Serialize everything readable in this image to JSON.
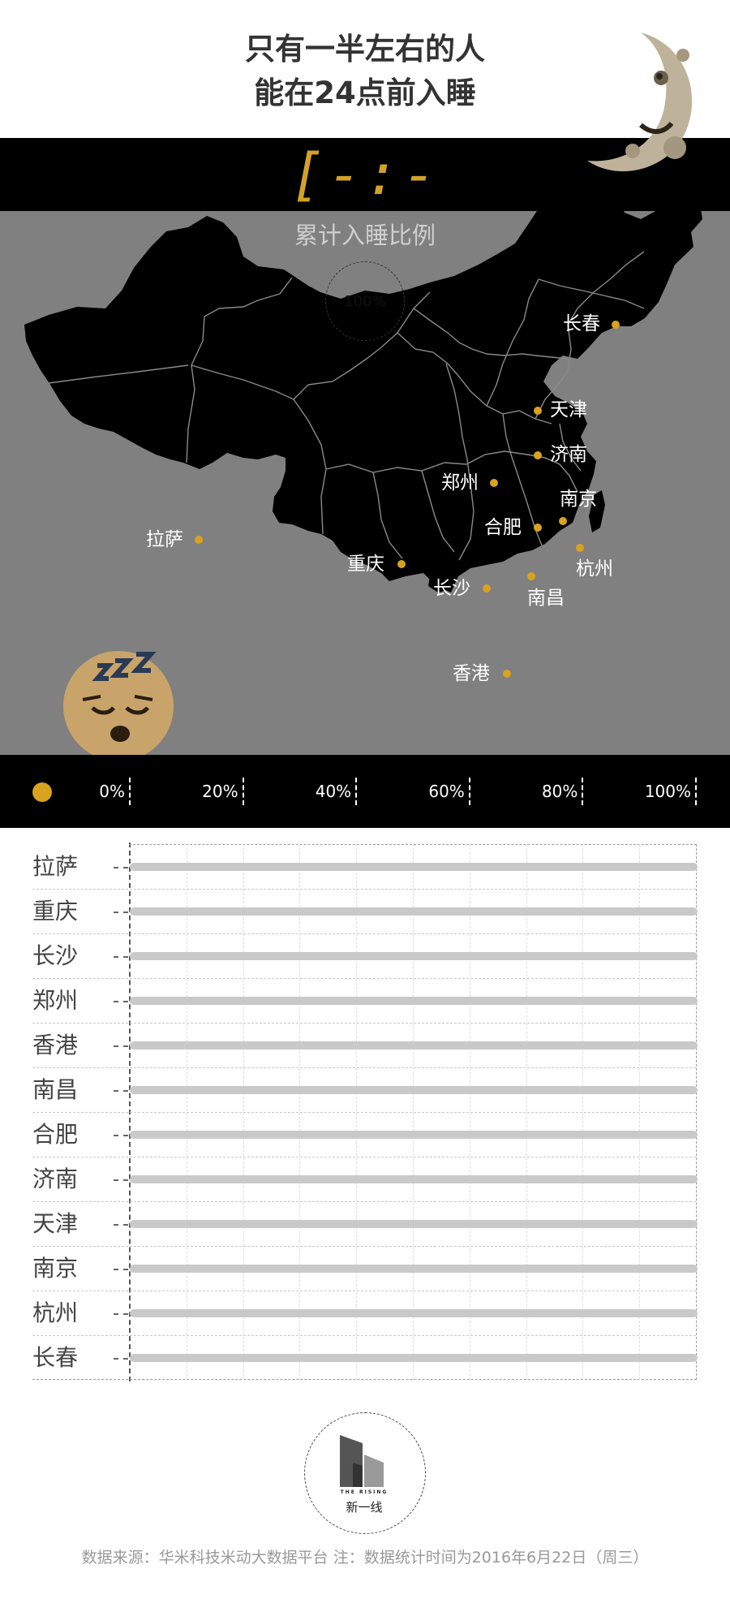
{
  "header": {
    "title_line1": "只有一半左右的人",
    "title_line2": "能在24点前入睡"
  },
  "clock": {
    "display": "[-:--]"
  },
  "map": {
    "subtitle": "累计入睡比例",
    "overall_percent": "100%",
    "cities": [
      {
        "name": "长春"
      },
      {
        "name": "天津"
      },
      {
        "name": "济南"
      },
      {
        "name": "郑州"
      },
      {
        "name": "南京"
      },
      {
        "name": "合肥"
      },
      {
        "name": "杭州"
      },
      {
        "name": "拉萨"
      },
      {
        "name": "重庆"
      },
      {
        "name": "长沙"
      },
      {
        "name": "南昌"
      },
      {
        "name": "香港"
      }
    ]
  },
  "colors": {
    "accent": "#d9a21f",
    "band": "#000000",
    "map_bg": "#808080",
    "track": "#c9c9c9"
  },
  "icons": {
    "moon": "crescent-moon-face-icon",
    "sleeping": "sleeping-face-icon",
    "logo": "the-rising-logo-icon"
  },
  "chart_data": {
    "type": "bar",
    "orientation": "horizontal",
    "title": "",
    "xlabel": "",
    "ylabel": "",
    "xlim": [
      0,
      100
    ],
    "legend_ticks": [
      "0%",
      "20%",
      "40%",
      "60%",
      "80%",
      "100%"
    ],
    "categories": [
      "拉萨",
      "重庆",
      "长沙",
      "郑州",
      "香港",
      "南昌",
      "合肥",
      "济南",
      "天津",
      "南京",
      "杭州",
      "长春"
    ],
    "values": [
      0,
      0,
      0,
      0,
      0,
      0,
      0,
      0,
      0,
      0,
      0,
      0
    ],
    "grid": true
  },
  "logo": {
    "tagline": "THE RISING",
    "name": "新一线"
  },
  "footer": {
    "text": "数据来源：华米科技米动大数据平台 注：数据统计时间为2016年6月22日（周三）"
  }
}
